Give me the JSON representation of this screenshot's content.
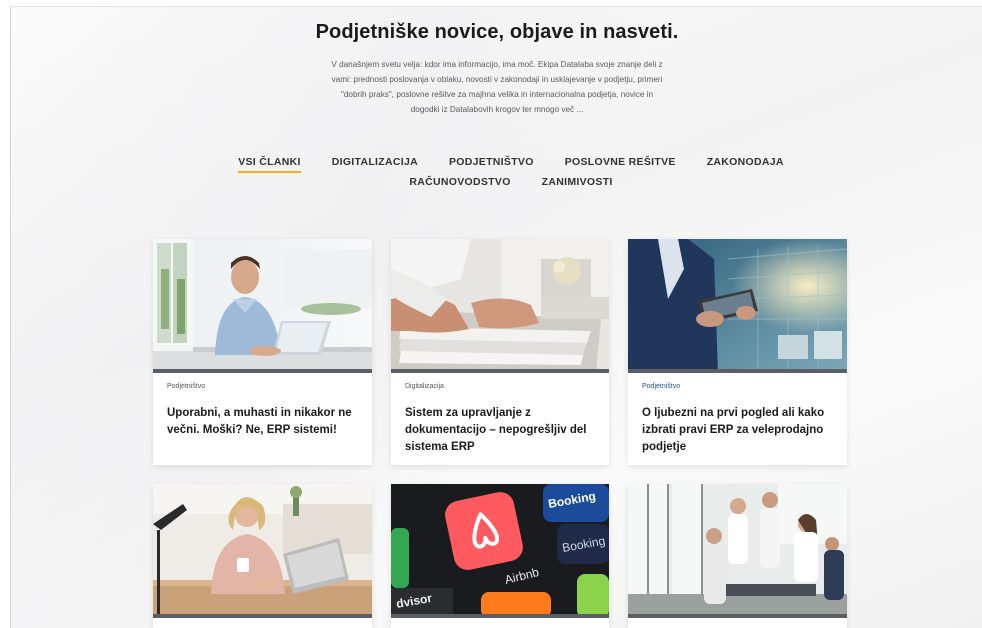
{
  "header": {
    "title": "Podjetniške novice, objave in nasveti.",
    "intro_lines": [
      "V današnjem svetu velja: kdor ima informacijo, ima moč. Ekipa Datalaba svoje znanje deli z",
      "vami: prednosti poslovanja v oblaku, novosti v zakonodaji in usklajevanje v podjetju, primeri",
      "\"dobrih praks\", poslovne rešitve za majhna velika in internacionalna podjetja, novice in",
      "dogodki iz Datalabovih krogov ter mnogo več ..."
    ]
  },
  "tabs": [
    {
      "label": "VSI ČLANKI",
      "active": true
    },
    {
      "label": "DIGITALIZACIJA",
      "active": false
    },
    {
      "label": "PODJETNIŠTVO",
      "active": false
    },
    {
      "label": "POSLOVNE REŠITVE",
      "active": false
    },
    {
      "label": "ZAKONODAJA",
      "active": false
    },
    {
      "label": "RAČUNOVODSTVO",
      "active": false
    },
    {
      "label": "ZANIMIVOSTI",
      "active": false
    }
  ],
  "articles": [
    {
      "category": "Podjetništvo",
      "title": "Uporabni, a muhasti in nikakor ne večni. Moški? Ne, ERP sistemi!",
      "image": "man-with-laptop-photo"
    },
    {
      "category": "Digitalizacija",
      "title": "Sistem za upravljanje z dokumentacijo – nepogrešljiv del sistema ERP",
      "image": "paper-documents-photo"
    },
    {
      "category": "Podjetništvo",
      "title": "O ljubezni na prvi pogled ali kako izbrati pravi ERP za veleprodajno podjetje",
      "image": "warehouse-tablet-photo"
    },
    {
      "category": "",
      "title": "",
      "image": "woman-with-coffee-laptop-photo"
    },
    {
      "category": "",
      "title": "",
      "image": "airbnb-booking-apps-photo"
    },
    {
      "category": "",
      "title": "",
      "image": "team-meeting-photo"
    }
  ],
  "photo_text": {
    "airbnb": "Airbnb",
    "booking1": "Booking",
    "booking2": "Booking",
    "advisor": "dvisor"
  },
  "colors": {
    "accent": "#f2b21a",
    "category_blue": "#2a4f8f",
    "airbnb": "#ff5a5f",
    "booking": "#1d4b9b"
  }
}
